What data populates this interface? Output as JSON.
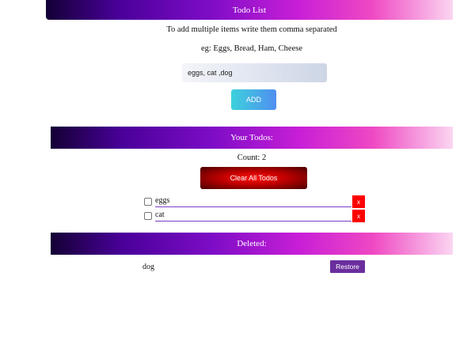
{
  "header": {
    "title": "Todo List"
  },
  "instructions": {
    "line1": "To add multiple items write them comma separated",
    "line2": "eg: Eggs, Bread, Ham, Cheese"
  },
  "input": {
    "value": "eggs, cat ,dog",
    "placeholder": ""
  },
  "add_button": {
    "label": "ADD"
  },
  "todos_section": {
    "title": "Your Todos:",
    "count_text": "Count: 2",
    "clear_label": "Clear All Todos",
    "items": [
      {
        "text": "eggs",
        "checked": false,
        "delete_label": "x"
      },
      {
        "text": "cat",
        "checked": false,
        "delete_label": "x"
      }
    ]
  },
  "deleted_section": {
    "title": "Deleted:",
    "items": [
      {
        "text": "dog",
        "restore_label": "Restore"
      }
    ]
  },
  "colors": {
    "banner_gradient": [
      "#140035",
      "#7d0cc6",
      "#ef48c3",
      "#fbd6f1"
    ],
    "add_button_gradient": [
      "#3dd1dc",
      "#4f8ff0"
    ],
    "clear_button": "#ff1414",
    "delete_button": "#ff0000",
    "restore_button": "#6b2e9e",
    "todo_underline": "#7a3ec6"
  }
}
